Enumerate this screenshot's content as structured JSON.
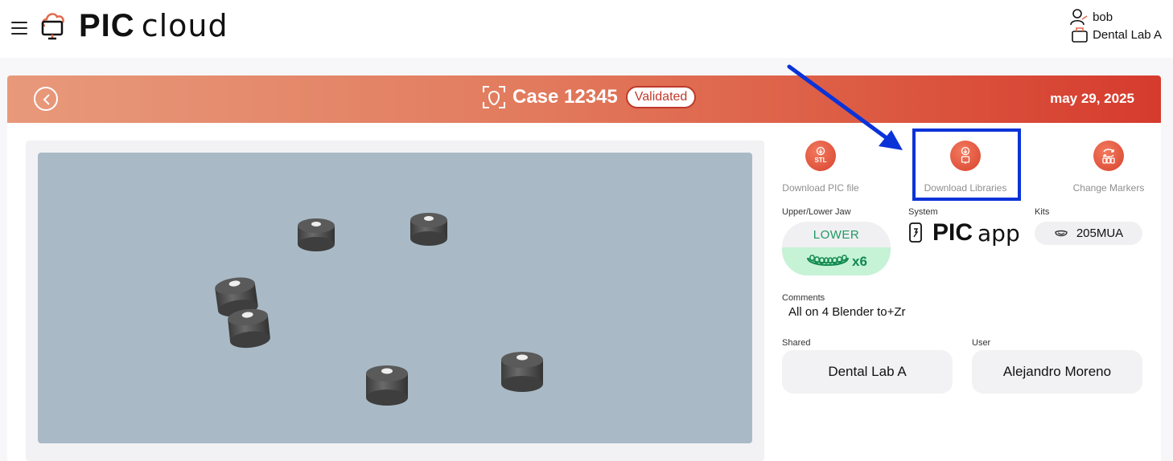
{
  "header": {
    "logo_primary": "PIC",
    "logo_secondary": "cloud",
    "user_name": "bob",
    "lab_name": "Dental Lab A"
  },
  "case": {
    "title": "Case 12345",
    "status": "Validated",
    "date": "may 29, 2025"
  },
  "actions": [
    {
      "label": "Download PIC file",
      "icon": "download-stl-icon"
    },
    {
      "label": "Download Libraries",
      "icon": "download-libraries-icon"
    },
    {
      "label": "Change Markers",
      "icon": "change-markers-icon"
    }
  ],
  "details": {
    "jaw_label": "Upper/Lower Jaw",
    "jaw_value": "LOWER",
    "jaw_count": "x6",
    "system_label": "System",
    "system_logo_primary": "PIC",
    "system_logo_secondary": "app",
    "kits_label": "Kits",
    "kits_value": "205MUA",
    "comments_label": "Comments",
    "comments_value": "All on 4 Blender to+Zr",
    "shared_label": "Shared",
    "shared_value": "Dental Lab A",
    "user_label": "User",
    "user_value": "Alejandro Moreno"
  },
  "colors": {
    "banner_start": "#e8997b",
    "banner_end": "#d63b2d",
    "accent": "#d8432e",
    "highlight": "#0a33d8",
    "jaw_green": "#1d9a63",
    "viewer_bg": "#a9bac6"
  }
}
